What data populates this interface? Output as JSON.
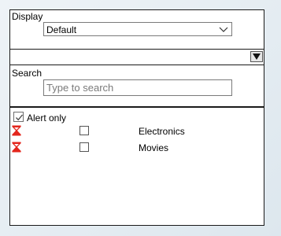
{
  "display": {
    "label": "Display",
    "selected": "Default"
  },
  "search": {
    "label": "Search",
    "placeholder": "Type to search",
    "value": ""
  },
  "alert_only": {
    "label": "Alert only",
    "checked": true
  },
  "items": [
    {
      "label": "Electronics",
      "icon": "hourglass-icon",
      "checked": false
    },
    {
      "label": "Movies",
      "icon": "hourglass-icon",
      "checked": false
    }
  ],
  "colors": {
    "alert_icon": "#e3261c",
    "panel_border": "#1a1a1a"
  }
}
